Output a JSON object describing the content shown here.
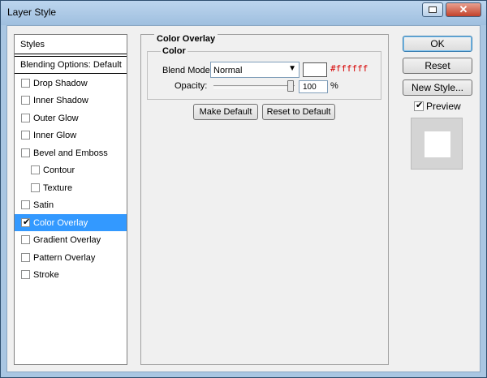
{
  "window": {
    "title": "Layer Style"
  },
  "sidebar": {
    "header": "Styles",
    "blending_options": "Blending Options: Default",
    "effects": [
      {
        "label": "Drop Shadow",
        "checked": false
      },
      {
        "label": "Inner Shadow",
        "checked": false
      },
      {
        "label": "Outer Glow",
        "checked": false
      },
      {
        "label": "Inner Glow",
        "checked": false
      },
      {
        "label": "Bevel and Emboss",
        "checked": false
      },
      {
        "label": "Contour",
        "checked": false
      },
      {
        "label": "Texture",
        "checked": false
      },
      {
        "label": "Satin",
        "checked": false
      },
      {
        "label": "Color Overlay",
        "checked": true
      },
      {
        "label": "Gradient Overlay",
        "checked": false
      },
      {
        "label": "Pattern Overlay",
        "checked": false
      },
      {
        "label": "Stroke",
        "checked": false
      }
    ]
  },
  "panel": {
    "title": "Color Overlay",
    "group_title": "Color",
    "blend_mode_label": "Blend Mode:",
    "blend_mode_value": "Normal",
    "color_hex": "#ffffff",
    "opacity_label": "Opacity:",
    "opacity_value": "100",
    "opacity_unit": "%",
    "make_default": "Make Default",
    "reset_to_default": "Reset to Default"
  },
  "actions": {
    "ok": "OK",
    "reset": "Reset",
    "new_style": "New Style...",
    "preview_label": "Preview",
    "preview_checked": true
  },
  "colors": {
    "selection": "#3399ff",
    "hex_text": "#d60000",
    "overlay_color": "#ffffff"
  }
}
